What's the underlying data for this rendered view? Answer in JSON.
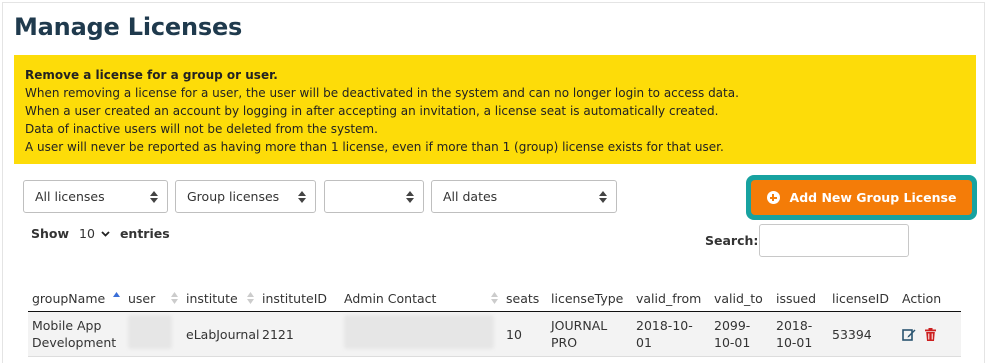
{
  "page": {
    "title": "Manage Licenses"
  },
  "notice": {
    "title": "Remove a license for a group or user.",
    "lines": [
      "When removing a license for a user, the user will be deactivated in the system and can no longer login to access data.",
      "When a user created an account by logging in after accepting an invitation, a license seat is automatically created.",
      "Data of inactive users will not be deleted from the system.",
      "A user will never be reported as having more than 1 license, even if more than 1 (group) license exists for that user."
    ]
  },
  "filters": {
    "license": "All licenses",
    "type": "Group licenses",
    "third": "",
    "dates": "All dates"
  },
  "add_button": {
    "label": "Add New Group License"
  },
  "length": {
    "show": "Show",
    "value": "10",
    "entries": "entries"
  },
  "search": {
    "label": "Search:",
    "value": ""
  },
  "table": {
    "columns": [
      "groupName",
      "user",
      "institute",
      "instituteID",
      "Admin Contact",
      "seats",
      "licenseType",
      "valid_from",
      "valid_to",
      "issued",
      "licenseID",
      "Action"
    ],
    "rows": [
      {
        "groupName": "Mobile App Development",
        "user": "",
        "institute": "eLabJournal",
        "instituteID": "2121",
        "admin_contact": "",
        "seats": "10",
        "licenseType": "JOURNAL PRO",
        "valid_from": "2018-10-01",
        "valid_to": "2099-10-01",
        "issued": "2018-10-01",
        "licenseID": "53394"
      }
    ]
  },
  "icons": {
    "edit": "edit-icon",
    "delete": "trash-icon",
    "add": "plus-circle-icon"
  },
  "colors": {
    "accent": "#f47c08",
    "notice_bg": "#fddc09",
    "highlight_ring": "#17a2a0",
    "title": "#1f3a4d",
    "delete": "#cc1f1f",
    "edit": "#2a5470"
  }
}
